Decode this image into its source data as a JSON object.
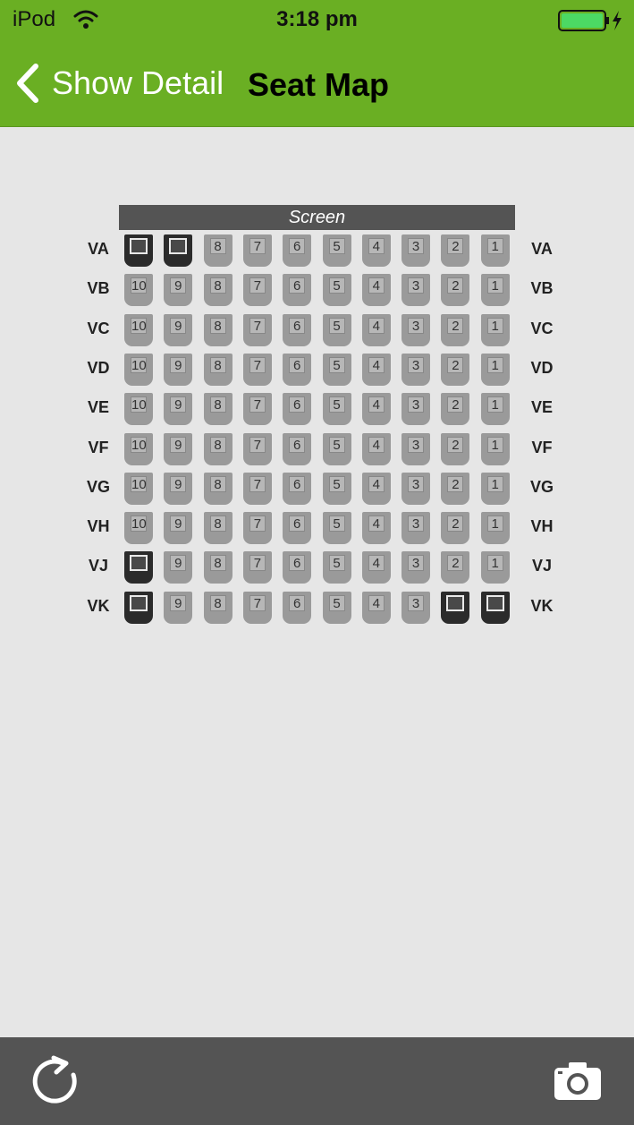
{
  "status_bar": {
    "carrier": "iPod",
    "time": "3:18 pm",
    "icons": [
      "wifi-icon",
      "battery-charging-icon"
    ]
  },
  "nav": {
    "back_label": "Show Detail",
    "title": "Seat Map"
  },
  "seat_map": {
    "screen_label": "Screen",
    "seat_numbers": [
      "10",
      "9",
      "8",
      "7",
      "6",
      "5",
      "4",
      "3",
      "2",
      "1"
    ],
    "rows": [
      {
        "label": "VA",
        "taken": [
          "10",
          "9"
        ]
      },
      {
        "label": "VB",
        "taken": []
      },
      {
        "label": "VC",
        "taken": []
      },
      {
        "label": "VD",
        "taken": []
      },
      {
        "label": "VE",
        "taken": []
      },
      {
        "label": "VF",
        "taken": []
      },
      {
        "label": "VG",
        "taken": []
      },
      {
        "label": "VH",
        "taken": []
      },
      {
        "label": "VJ",
        "taken": [
          "10"
        ]
      },
      {
        "label": "VK",
        "taken": [
          "10",
          "2",
          "1"
        ]
      }
    ],
    "colors": {
      "available": "#9a9a9a",
      "taken": "#2b2b2b",
      "screen": "#545454"
    }
  },
  "toolbar": {
    "icons": [
      "refresh-icon",
      "camera-icon"
    ]
  },
  "theme": {
    "accent": "#6aaf23",
    "background": "#e6e6e6",
    "toolbar": "#545454"
  }
}
